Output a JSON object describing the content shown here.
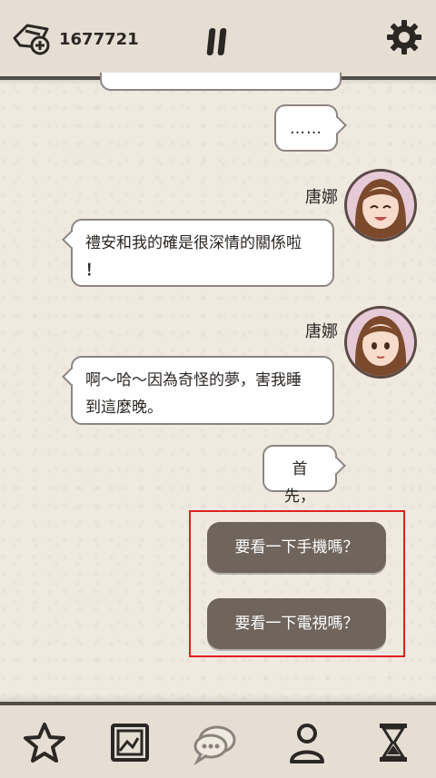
{
  "header": {
    "coin_count": "1677721"
  },
  "chat": {
    "partial_bubble": "",
    "messages": [
      {
        "side": "right",
        "text": "……"
      },
      {
        "side": "left",
        "speaker": "唐娜",
        "text_line1": "禮安和我的確是很深情的關係啦",
        "text_line2": "！"
      },
      {
        "side": "left",
        "speaker": "唐娜",
        "text_line1": "啊～哈～因為奇怪的夢，害我睡",
        "text_line2": "到這麼晚。"
      },
      {
        "side": "right",
        "text": "首先，"
      }
    ]
  },
  "choices": [
    {
      "label": "要看一下手機嗎？"
    },
    {
      "label": "要看一下電視嗎？"
    }
  ],
  "nav": {
    "items": [
      {
        "icon": "star-icon"
      },
      {
        "icon": "gallery-icon"
      },
      {
        "icon": "chat-icon"
      },
      {
        "icon": "profile-icon"
      },
      {
        "icon": "hourglass-icon"
      }
    ],
    "active_index": 2
  },
  "colors": {
    "accent_choice": "#6f655d",
    "highlight_box": "#e02020",
    "bar_bg": "#e6ded3"
  }
}
